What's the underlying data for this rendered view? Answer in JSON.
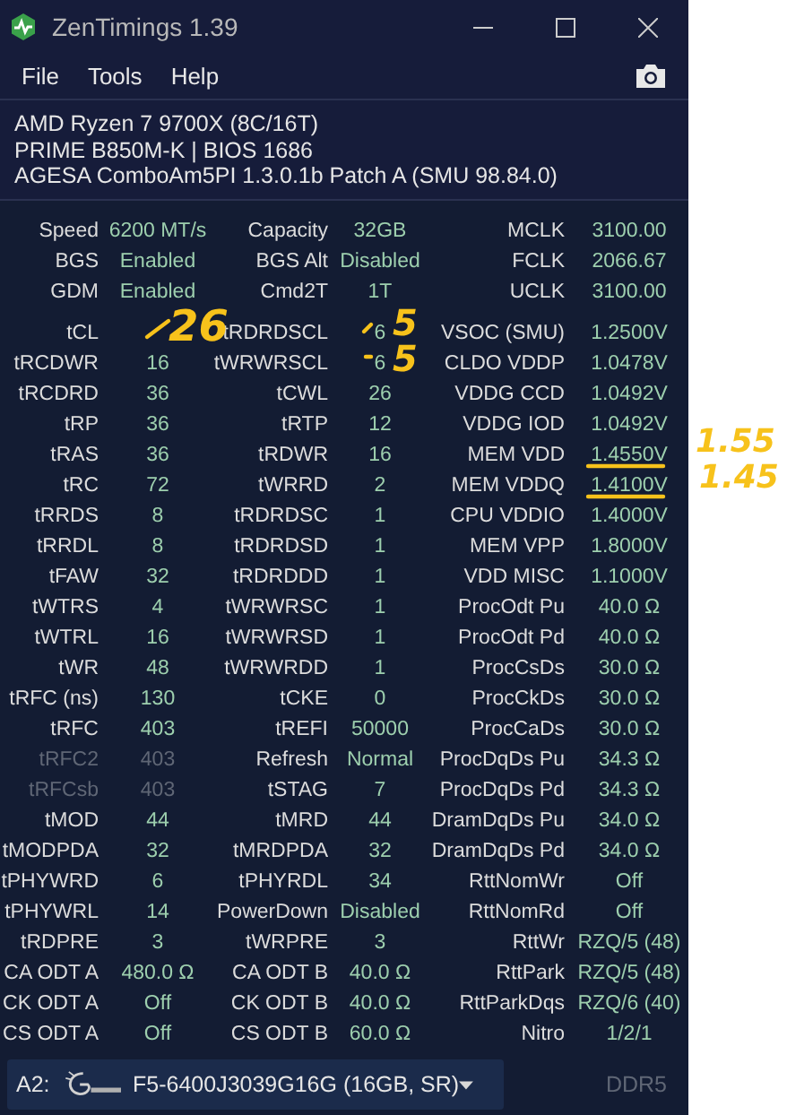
{
  "window": {
    "title": "ZenTimings 1.39"
  },
  "menu": [
    "File",
    "Tools",
    "Help"
  ],
  "system_info": [
    "AMD Ryzen 7 9700X (8C/16T)",
    "PRIME B850M-K | BIOS 1686",
    "AGESA ComboAm5PI 1.3.0.1b Patch A (SMU 98.84.0)"
  ],
  "summary": [
    [
      {
        "label": "Speed",
        "value": "6200 MT/s",
        "dimmed": false
      },
      {
        "label": "Capacity",
        "value": "32GB",
        "dimmed": false
      },
      {
        "label": "MCLK",
        "value": "3100.00",
        "dimmed": false
      }
    ],
    [
      {
        "label": "BGS",
        "value": "Enabled",
        "dimmed": false
      },
      {
        "label": "BGS Alt",
        "value": "Disabled",
        "dimmed": false
      },
      {
        "label": "FCLK",
        "value": "2066.67",
        "dimmed": false
      }
    ],
    [
      {
        "label": "GDM",
        "value": "Enabled",
        "dimmed": false
      },
      {
        "label": "Cmd2T",
        "value": "1T",
        "dimmed": false
      },
      {
        "label": "UCLK",
        "value": "3100.00",
        "dimmed": false
      }
    ]
  ],
  "timings": [
    [
      {
        "label": "tCL",
        "dimmed": false
      },
      {
        "label": "tRDRDSCL",
        "value": "6",
        "dimmed": false
      },
      {
        "label": "VSOC (SMU)",
        "value": "1.2500V",
        "dimmed": false
      }
    ],
    [
      {
        "label": "tRCDWR",
        "value": "16",
        "dimmed": false
      },
      {
        "label": "tWRWRSCL",
        "value": "6",
        "dimmed": false
      },
      {
        "label": "CLDO VDDP",
        "value": "1.0478V",
        "dimmed": false
      }
    ],
    [
      {
        "label": "tRCDRD",
        "value": "36",
        "dimmed": false
      },
      {
        "label": "tCWL",
        "value": "26",
        "dimmed": false
      },
      {
        "label": "VDDG CCD",
        "value": "1.0492V",
        "dimmed": false
      }
    ],
    [
      {
        "label": "tRP",
        "value": "36",
        "dimmed": false
      },
      {
        "label": "tRTP",
        "value": "12",
        "dimmed": false
      },
      {
        "label": "VDDG IOD",
        "value": "1.0492V",
        "dimmed": false
      }
    ],
    [
      {
        "label": "tRAS",
        "value": "36",
        "dimmed": false
      },
      {
        "label": "tRDWR",
        "value": "16",
        "dimmed": false
      },
      {
        "label": "MEM VDD",
        "value": "1.4550V",
        "dimmed": false
      }
    ],
    [
      {
        "label": "tRC",
        "value": "72",
        "dimmed": false
      },
      {
        "label": "tWRRD",
        "value": "2",
        "dimmed": false
      },
      {
        "label": "MEM VDDQ",
        "value": "1.4100V",
        "dimmed": false
      }
    ],
    [
      {
        "label": "tRRDS",
        "value": "8",
        "dimmed": false
      },
      {
        "label": "tRDRDSC",
        "value": "1",
        "dimmed": false
      },
      {
        "label": "CPU VDDIO",
        "value": "1.4000V",
        "dimmed": false
      }
    ],
    [
      {
        "label": "tRRDL",
        "value": "8",
        "dimmed": false
      },
      {
        "label": "tRDRDSD",
        "value": "1",
        "dimmed": false
      },
      {
        "label": "MEM VPP",
        "value": "1.8000V",
        "dimmed": false
      }
    ],
    [
      {
        "label": "tFAW",
        "value": "32",
        "dimmed": false
      },
      {
        "label": "tRDRDDD",
        "value": "1",
        "dimmed": false
      },
      {
        "label": "VDD MISC",
        "value": "1.1000V",
        "dimmed": false
      }
    ],
    [
      {
        "label": "tWTRS",
        "value": "4",
        "dimmed": false
      },
      {
        "label": "tWRWRSC",
        "value": "1",
        "dimmed": false
      },
      {
        "label": "ProcOdt Pu",
        "value": "40.0 Ω",
        "dimmed": false
      }
    ],
    [
      {
        "label": "tWTRL",
        "value": "16",
        "dimmed": false
      },
      {
        "label": "tWRWRSD",
        "value": "1",
        "dimmed": false
      },
      {
        "label": "ProcOdt Pd",
        "value": "40.0 Ω",
        "dimmed": false
      }
    ],
    [
      {
        "label": "tWR",
        "value": "48",
        "dimmed": false
      },
      {
        "label": "tWRWRDD",
        "value": "1",
        "dimmed": false
      },
      {
        "label": "ProcCsDs",
        "value": "30.0 Ω",
        "dimmed": false
      }
    ],
    [
      {
        "label": "tRFC (ns)",
        "value": "130",
        "dimmed": false
      },
      {
        "label": "tCKE",
        "value": "0",
        "dimmed": false
      },
      {
        "label": "ProcCkDs",
        "value": "30.0 Ω",
        "dimmed": false
      }
    ],
    [
      {
        "label": "tRFC",
        "value": "403",
        "dimmed": false
      },
      {
        "label": "tREFI",
        "value": "50000",
        "dimmed": false
      },
      {
        "label": "ProcCaDs",
        "value": "30.0 Ω",
        "dimmed": false
      }
    ],
    [
      {
        "label": "tRFC2",
        "value": "403",
        "dimmed": true
      },
      {
        "label": "Refresh",
        "value": "Normal",
        "dimmed": false
      },
      {
        "label": "ProcDqDs Pu",
        "value": "34.3 Ω",
        "dimmed": false
      }
    ],
    [
      {
        "label": "tRFCsb",
        "value": "403",
        "dimmed": true
      },
      {
        "label": "tSTAG",
        "value": "7",
        "dimmed": false
      },
      {
        "label": "ProcDqDs Pd",
        "value": "34.3 Ω",
        "dimmed": false
      }
    ],
    [
      {
        "label": "tMOD",
        "value": "44",
        "dimmed": false
      },
      {
        "label": "tMRD",
        "value": "44",
        "dimmed": false
      },
      {
        "label": "DramDqDs Pu",
        "value": "34.0 Ω",
        "dimmed": false
      }
    ],
    [
      {
        "label": "tMODPDA",
        "value": "32",
        "dimmed": false
      },
      {
        "label": "tMRDPDA",
        "value": "32",
        "dimmed": false
      },
      {
        "label": "DramDqDs Pd",
        "value": "34.0 Ω",
        "dimmed": false
      }
    ],
    [
      {
        "label": "tPHYWRD",
        "value": "6",
        "dimmed": false
      },
      {
        "label": "tPHYRDL",
        "value": "34",
        "dimmed": false
      },
      {
        "label": "RttNomWr",
        "value": "Off",
        "dimmed": false
      }
    ],
    [
      {
        "label": "tPHYWRL",
        "value": "14",
        "dimmed": false
      },
      {
        "label": "PowerDown",
        "value": "Disabled",
        "dimmed": false
      },
      {
        "label": "RttNomRd",
        "value": "Off",
        "dimmed": false
      }
    ],
    [
      {
        "label": "tRDPRE",
        "value": "3",
        "dimmed": false
      },
      {
        "label": "tWRPRE",
        "value": "3",
        "dimmed": false
      },
      {
        "label": "RttWr",
        "value": "RZQ/5 (48)",
        "dimmed": false
      }
    ],
    [
      {
        "label": "CA ODT A",
        "value": "480.0 Ω",
        "dimmed": false
      },
      {
        "label": "CA ODT B",
        "value": "40.0 Ω",
        "dimmed": false
      },
      {
        "label": "RttPark",
        "value": "RZQ/5 (48)",
        "dimmed": false
      }
    ],
    [
      {
        "label": "CK ODT A",
        "value": "Off",
        "dimmed": false
      },
      {
        "label": "CK ODT B",
        "value": "40.0 Ω",
        "dimmed": false
      },
      {
        "label": "RttParkDqs",
        "value": "RZQ/6 (40)",
        "dimmed": false
      }
    ],
    [
      {
        "label": "CS ODT A",
        "value": "Off",
        "dimmed": false
      },
      {
        "label": "CS ODT B",
        "value": "60.0 Ω",
        "dimmed": false
      },
      {
        "label": "Nitro",
        "value": "1/2/1",
        "dimmed": false
      }
    ]
  ],
  "module_selector": {
    "slot": "A2:",
    "value": "F5-6400J3039G16G (16GB, SR)"
  },
  "memory_type": "DDR5",
  "handwritten_notes": [
    "26",
    "5",
    "5",
    "1.55",
    "1.45"
  ]
}
